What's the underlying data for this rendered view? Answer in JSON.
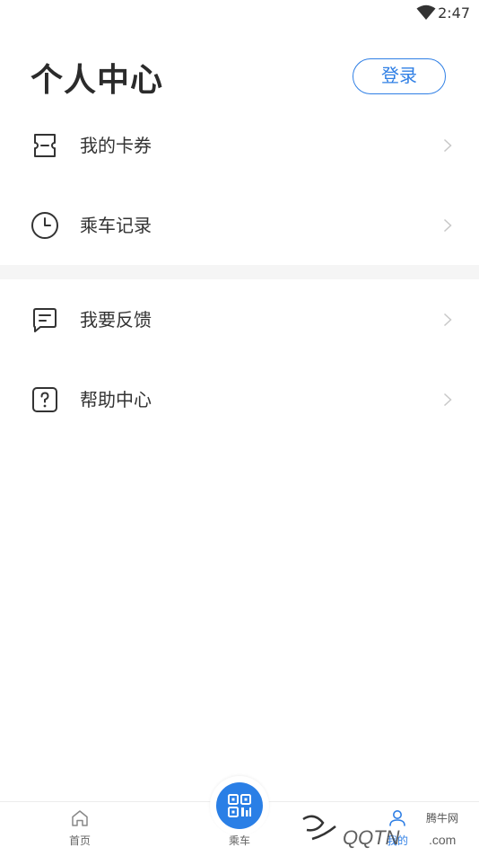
{
  "status_bar": {
    "time": "2:47",
    "wifi_icon": "wifi-icon"
  },
  "header": {
    "title": "个人中心",
    "login_label": "登录"
  },
  "menu": [
    {
      "label": "我的卡券",
      "icon": "ticket-icon"
    },
    {
      "label": "乘车记录",
      "icon": "clock-icon"
    },
    {
      "label": "我要反馈",
      "icon": "message-icon"
    },
    {
      "label": "帮助中心",
      "icon": "help-icon"
    }
  ],
  "tab_bar": {
    "home_label": "首页",
    "ride_label": "乘车",
    "mine_label": "我的"
  },
  "watermark": {
    "text": "腾牛网"
  },
  "colors": {
    "accent": "#2f7fe5",
    "divider": "#f5f5f5",
    "text": "#333333"
  }
}
